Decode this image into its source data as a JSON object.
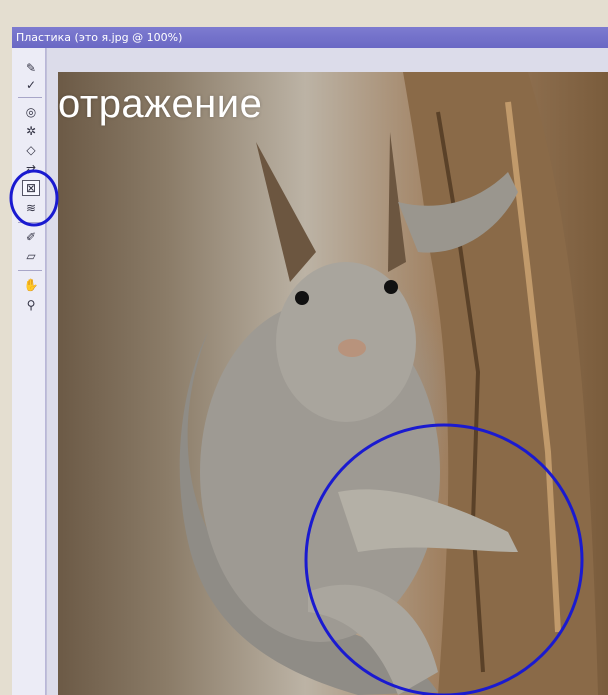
{
  "window": {
    "title": "Пластика (это я.jpg @ 100%)"
  },
  "slide": {
    "heading": "отражение"
  },
  "tools": [
    {
      "name": "forward-warp-tool",
      "glyph": "✎"
    },
    {
      "name": "reconstruct-tool",
      "glyph": "✓"
    },
    {
      "name": "twirl-tool",
      "glyph": "◎"
    },
    {
      "name": "pucker-tool",
      "glyph": "✲"
    },
    {
      "name": "bloat-tool",
      "glyph": "◇"
    },
    {
      "name": "push-left-tool",
      "glyph": "⇄"
    },
    {
      "name": "mirror-tool",
      "glyph": "⊠"
    },
    {
      "name": "turbulence-tool",
      "glyph": "≋"
    },
    {
      "name": "freeze-mask-tool",
      "glyph": "✐"
    },
    {
      "name": "thaw-mask-tool",
      "glyph": "▱"
    },
    {
      "name": "hand-tool",
      "glyph": "✋"
    },
    {
      "name": "zoom-tool",
      "glyph": "⚲"
    }
  ],
  "highlight_color": "#1a1ad0",
  "title_bar_color": "#7473c9"
}
